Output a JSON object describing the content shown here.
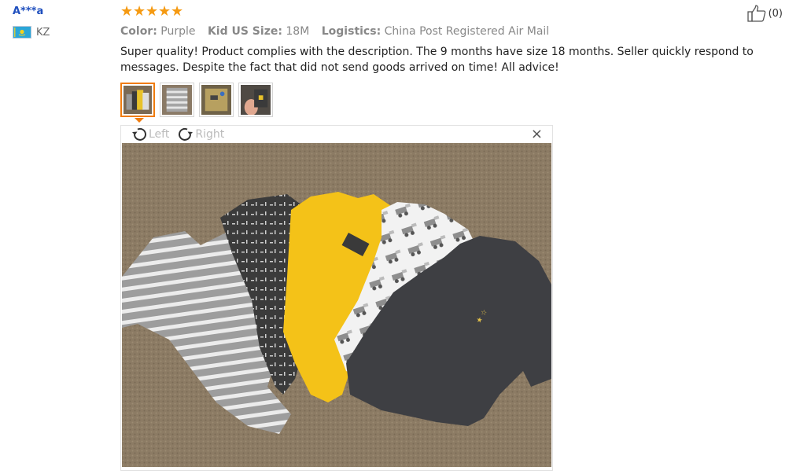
{
  "review": {
    "user": "A***a",
    "country_code": "KZ",
    "stars": 5,
    "color_label": "Color:",
    "color_value": "Purple",
    "size_label": "Kid US Size:",
    "size_value": "18M",
    "logistics_label": "Logistics:",
    "logistics_value": "China Post Registered Air Mail",
    "text": "Super quality! Product complies with the description. The 9 months have size 18 months. Seller quickly respond to messages. Despite the fact that did not send goods arrived on time! All advice!",
    "likes": "(0)"
  },
  "viewer": {
    "rotate_left": "Left",
    "rotate_right": "Right",
    "close": "×"
  },
  "colors": {
    "star": "#f59a12",
    "accent": "#f07c0e",
    "user_link": "#1f4fbe"
  }
}
